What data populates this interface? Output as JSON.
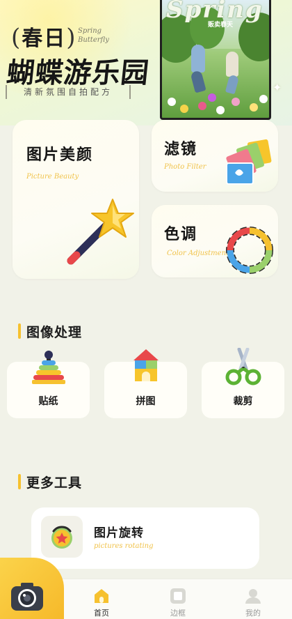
{
  "banner": {
    "title_line1": "春日",
    "title_script_line1": "Spring",
    "title_script_line2": "Butterfly",
    "title_line2": "蝴蝶游乐园",
    "subtitle": "清新氛围自拍配方",
    "photo_headline": "Spring",
    "photo_caption": "贩卖春天"
  },
  "features": [
    {
      "title": "图片美颜",
      "subtitle": "Picture Beauty",
      "icon": "magic-wand-icon"
    },
    {
      "title": "滤镜",
      "subtitle": "Photo Filter",
      "icon": "photo-stack-icon"
    },
    {
      "title": "色调",
      "subtitle": "Color Adjustment",
      "icon": "color-ring-icon"
    }
  ],
  "sections": {
    "image_processing": "图像处理",
    "more_tools": "更多工具"
  },
  "tools": [
    {
      "label": "贴纸",
      "icon": "stacking-rings-icon"
    },
    {
      "label": "拼图",
      "icon": "building-blocks-icon"
    },
    {
      "label": "裁剪",
      "icon": "scissors-icon"
    }
  ],
  "more_tools": [
    {
      "title": "图片旋转",
      "subtitle": "pictures rotating",
      "icon": "star-badge-icon"
    }
  ],
  "nav": [
    {
      "label": "首页",
      "icon": "home-icon",
      "active": true
    },
    {
      "label": "边框",
      "icon": "frame-icon",
      "active": false
    },
    {
      "label": "我的",
      "icon": "profile-icon",
      "active": false
    }
  ],
  "colors": {
    "accent": "#f6c12f",
    "subtitle_yellow": "#f0c24a",
    "background": "#f1f2e8"
  }
}
